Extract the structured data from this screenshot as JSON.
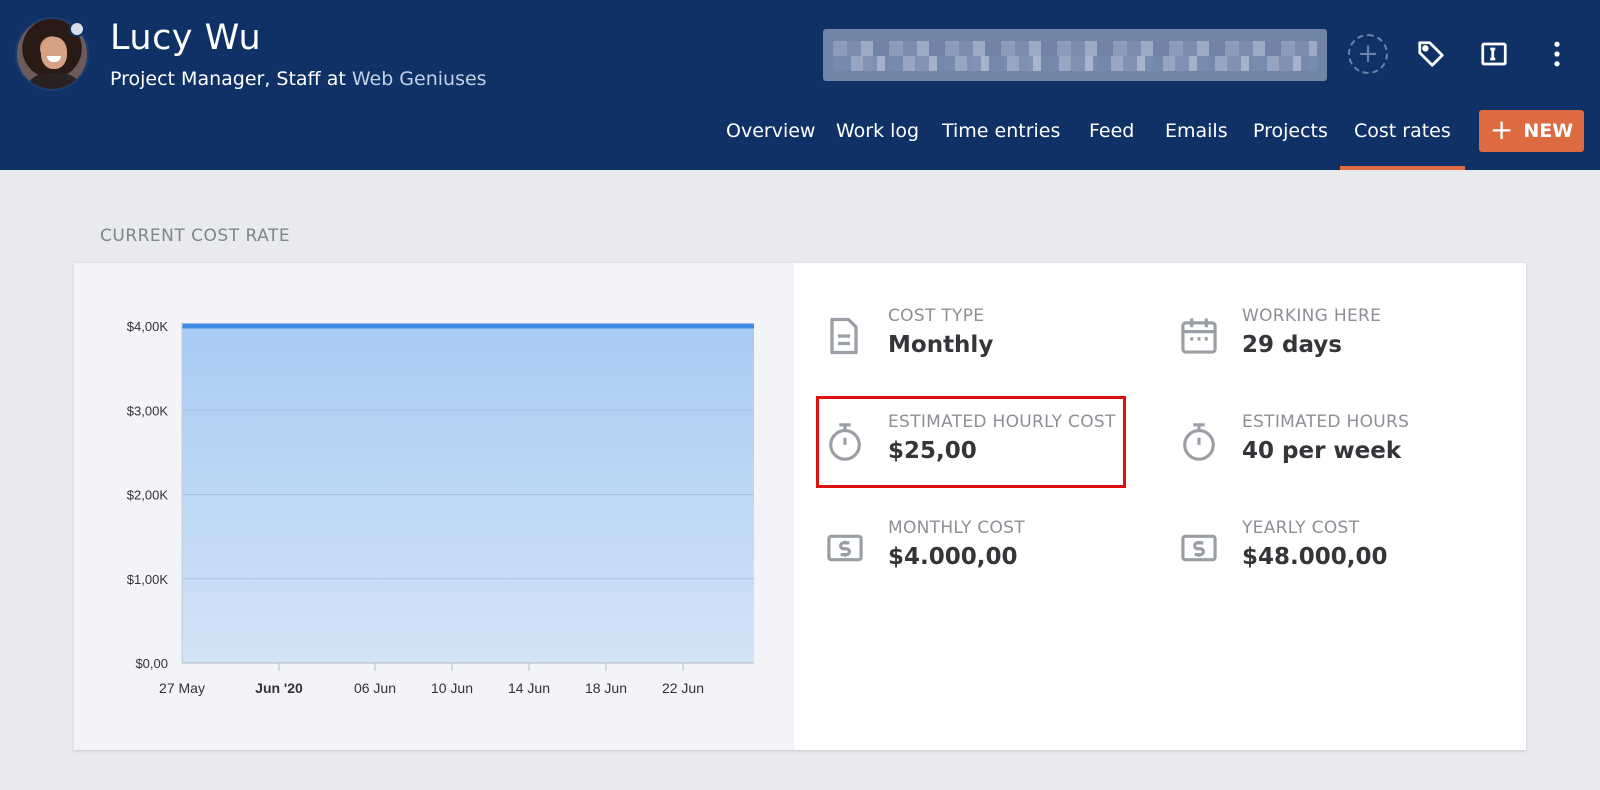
{
  "profile": {
    "name": "Lucy Wu",
    "role_prefix": "Project Manager, Staff at ",
    "company": "Web Geniuses"
  },
  "header_icons": [
    "add-icon",
    "tag-icon",
    "text-field-icon",
    "more-vertical-icon"
  ],
  "nav": {
    "tabs": [
      "Overview",
      "Work log",
      "Time entries",
      "Feed",
      "Emails",
      "Projects",
      "Cost rates"
    ],
    "active": "Cost rates"
  },
  "new_button": {
    "label": "NEW"
  },
  "section": {
    "title": "CURRENT COST RATE"
  },
  "stats": [
    {
      "label": "COST TYPE",
      "value": "Monthly",
      "icon": "document-icon"
    },
    {
      "label": "WORKING HERE",
      "value": "29 days",
      "icon": "calendar-icon"
    },
    {
      "label": "ESTIMATED HOURLY COST",
      "value": "$25,00",
      "icon": "stopwatch-icon"
    },
    {
      "label": "ESTIMATED HOURS",
      "value": "40 per week",
      "icon": "stopwatch-icon"
    },
    {
      "label": "MONTHLY COST",
      "value": "$4.000,00",
      "icon": "dollar-bill-icon"
    },
    {
      "label": "YEARLY COST",
      "value": "$48.000,00",
      "icon": "dollar-bill-icon"
    }
  ],
  "colors": {
    "header_bg": "#0f3166",
    "accent": "#de6a42",
    "area_fill": "#b3d0f4",
    "line": "#3d8be6",
    "highlight": "#de1111"
  },
  "chart_data": {
    "type": "area",
    "x": [
      "27 May",
      "Jun '20",
      "06 Jun",
      "10 Jun",
      "14 Jun",
      "18 Jun",
      "22 Jun"
    ],
    "x_bold": [
      "Jun '20"
    ],
    "series": [
      {
        "values": [
          4000,
          4000,
          4000,
          4000,
          4000,
          4000,
          4000,
          4000
        ]
      }
    ],
    "y_ticks": [
      "$0,00",
      "$1,00K",
      "$2,00K",
      "$3,00K",
      "$4,00K"
    ],
    "y_tick_values": [
      0,
      1000,
      2000,
      3000,
      4000
    ],
    "ylim": [
      0,
      4000
    ],
    "grid": true
  }
}
